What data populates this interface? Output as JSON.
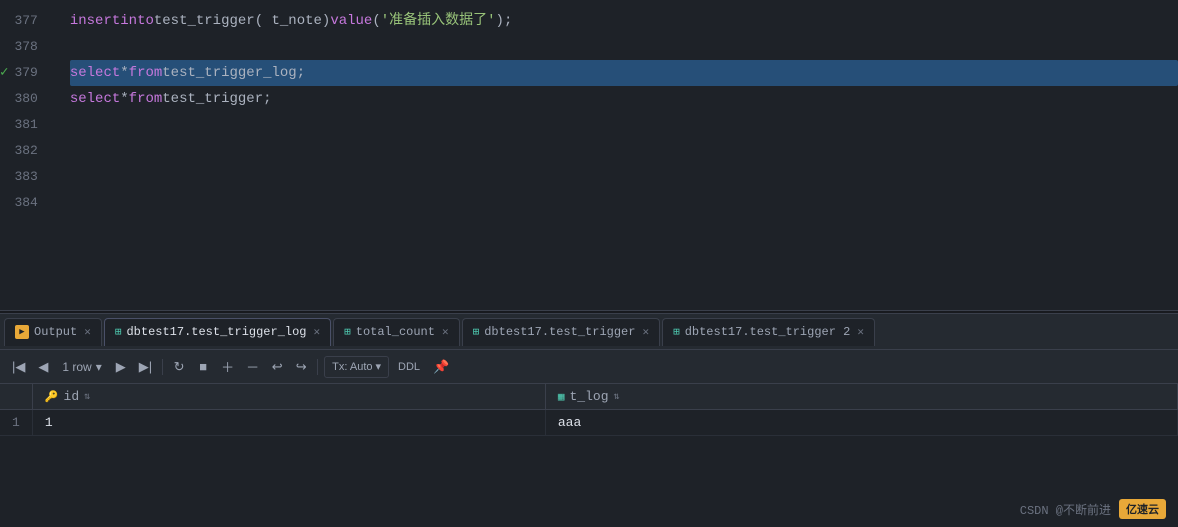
{
  "editor": {
    "lines": [
      {
        "num": "377",
        "content": "insert_line",
        "hasCheck": false
      },
      {
        "num": "378",
        "content": "empty",
        "hasCheck": false
      },
      {
        "num": "379",
        "content": "select_trigger_log",
        "hasCheck": true
      },
      {
        "num": "380",
        "content": "select_trigger",
        "hasCheck": false
      },
      {
        "num": "381",
        "content": "empty",
        "hasCheck": false
      },
      {
        "num": "382",
        "content": "empty",
        "hasCheck": false
      },
      {
        "num": "383",
        "content": "empty",
        "hasCheck": false
      },
      {
        "num": "384",
        "content": "empty",
        "hasCheck": false
      }
    ],
    "code": {
      "insert_line": "insert into test_trigger( t_note) value ('准备插入数据了');",
      "select_trigger_log": "select * from test_trigger_log;",
      "select_trigger": "select * from test_trigger;"
    }
  },
  "tabs": [
    {
      "id": "output",
      "label": "Output",
      "icon": "output",
      "active": false,
      "closable": true
    },
    {
      "id": "trigger_log",
      "label": "dbtest17.test_trigger_log",
      "icon": "table",
      "active": true,
      "closable": true
    },
    {
      "id": "total_count",
      "label": "total_count",
      "icon": "table",
      "active": false,
      "closable": true
    },
    {
      "id": "test_trigger",
      "label": "dbtest17.test_trigger",
      "icon": "table",
      "active": false,
      "closable": true
    },
    {
      "id": "test_trigger2",
      "label": "dbtest17.test_trigger 2",
      "icon": "table",
      "active": false,
      "closable": true
    }
  ],
  "toolbar": {
    "row_count": "1 row",
    "tx_auto": "Tx: Auto",
    "ddl": "DDL"
  },
  "grid": {
    "columns": [
      {
        "name": "id",
        "icon": "key"
      },
      {
        "name": "t_log",
        "icon": "col"
      }
    ],
    "rows": [
      {
        "rownum": "1",
        "id": "1",
        "t_log": "aaa"
      }
    ]
  },
  "watermark": {
    "text": "CSDN @不断前进",
    "badge": "亿速云"
  }
}
